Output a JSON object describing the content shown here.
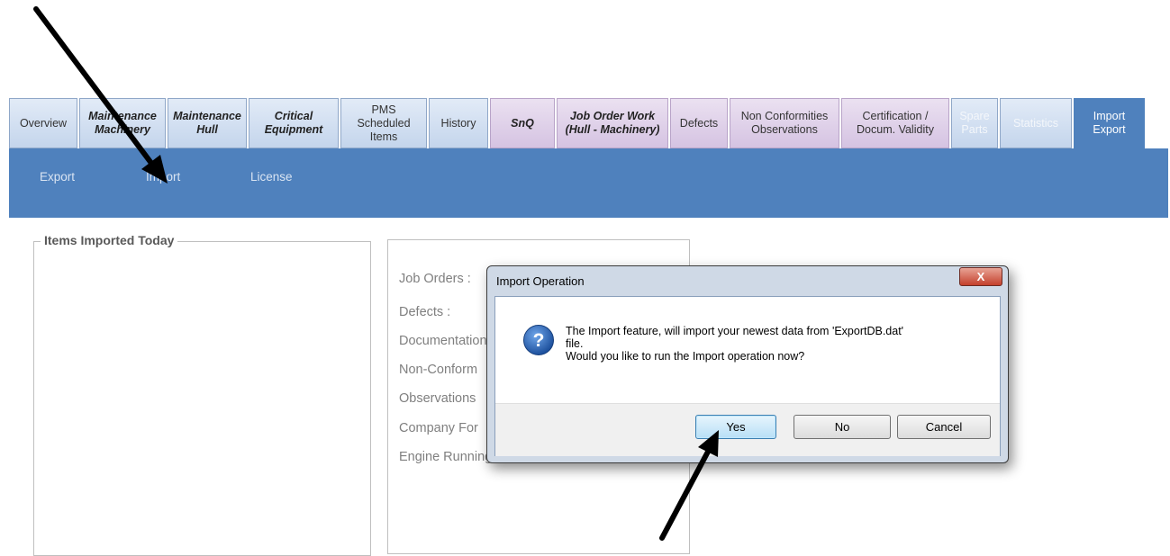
{
  "tabs": [
    {
      "label": "Overview",
      "style": "normal"
    },
    {
      "label": "Maintenance Machinery",
      "style": "bold-italic"
    },
    {
      "label": "Maintenance Hull",
      "style": "bold-italic"
    },
    {
      "label": "Critical Equipment",
      "style": "bold-italic"
    },
    {
      "label": "PMS Scheduled Items",
      "style": "normal"
    },
    {
      "label": "History",
      "style": "normal"
    },
    {
      "label": "SnQ",
      "style": "bold-italic-purple"
    },
    {
      "label": "Job Order Work (Hull - Machinery)",
      "style": "bold-italic-purple"
    },
    {
      "label": "Defects",
      "style": "purple"
    },
    {
      "label": "Non Conformities Observations",
      "style": "purple"
    },
    {
      "label": "Certification / Docum. Validity",
      "style": "purple"
    },
    {
      "label": "Spare Parts",
      "style": "disabled"
    },
    {
      "label": "Statistics",
      "style": "disabled"
    },
    {
      "label": "Import Export",
      "style": "active"
    }
  ],
  "subnav": {
    "export": "Export",
    "import": "Import",
    "license": "License"
  },
  "items_group": {
    "title": "Items Imported Today"
  },
  "counts": {
    "labels": [
      "Job Orders :",
      "Defects :",
      "Documentation",
      "Non-Conform",
      "Observations",
      "Company For",
      "Engine Running Hrs :"
    ]
  },
  "dialog": {
    "title": "Import Operation",
    "close_glyph": "X",
    "icon": "question-icon",
    "message_line1": "The Import feature, will import your newest data from 'ExportDB.dat'",
    "message_line2": "file.",
    "message_line3": "Would you like to run the Import operation now?",
    "buttons": {
      "yes": "Yes",
      "no": "No",
      "cancel": "Cancel"
    }
  },
  "colors": {
    "active_tab": "#4f81bd",
    "subbar": "#4f81bd",
    "tab_blue": "#c4d5ec",
    "tab_purple": "#d5c3e2",
    "annotation_arrow": "#000000"
  }
}
